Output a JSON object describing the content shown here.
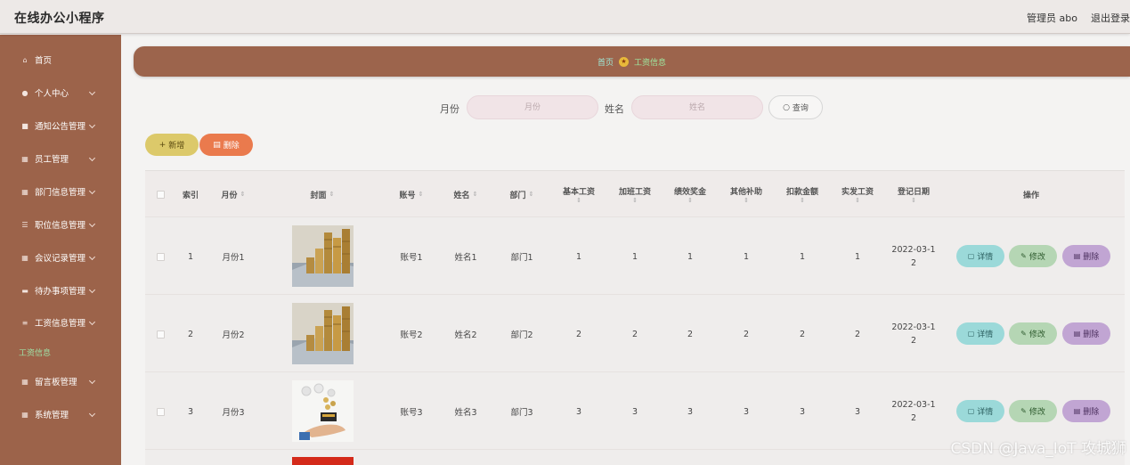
{
  "app": {
    "title": "在线办公小程序",
    "user": "管理员 abo",
    "logout": "退出登录"
  },
  "sidebar": {
    "items": [
      {
        "label": "首页",
        "icon": "home-icon",
        "expandable": false
      },
      {
        "label": "个人中心",
        "icon": "user-icon",
        "expandable": true
      },
      {
        "label": "通知公告管理",
        "icon": "notice-icon",
        "expandable": true
      },
      {
        "label": "员工管理",
        "icon": "grid-icon",
        "expandable": true
      },
      {
        "label": "部门信息管理",
        "icon": "grid-icon",
        "expandable": true
      },
      {
        "label": "职位信息管理",
        "icon": "sliders-icon",
        "expandable": true
      },
      {
        "label": "会议记录管理",
        "icon": "grid-icon",
        "expandable": true
      },
      {
        "label": "待办事项管理",
        "icon": "chat-icon",
        "expandable": true
      },
      {
        "label": "工资信息管理",
        "icon": "list-icon",
        "expandable": true
      },
      {
        "label": "留言板管理",
        "icon": "grid-icon",
        "expandable": true
      },
      {
        "label": "系统管理",
        "icon": "grid-icon",
        "expandable": true
      }
    ],
    "submenu_label": "工资信息"
  },
  "breadcrumb": {
    "home": "首页",
    "current": "工资信息"
  },
  "search": {
    "month_label": "月份",
    "month_placeholder": "月份",
    "name_label": "姓名",
    "name_placeholder": "姓名",
    "button": "查询"
  },
  "actions": {
    "add": "新增",
    "delete": "删除"
  },
  "table": {
    "columns": [
      "索引",
      "月份",
      "封面",
      "账号",
      "姓名",
      "部门",
      "基本工资",
      "加班工资",
      "绩效奖金",
      "其他补助",
      "扣款金额",
      "实发工资",
      "登记日期",
      "操作"
    ],
    "rows": [
      {
        "index": "1",
        "month": "月份1",
        "account": "账号1",
        "name": "姓名1",
        "dept": "部门1",
        "base": "1",
        "overtime": "1",
        "bonus": "1",
        "other": "1",
        "deduct": "1",
        "actual": "1",
        "date_line1": "2022-03-1",
        "date_line2": "2"
      },
      {
        "index": "2",
        "month": "月份2",
        "account": "账号2",
        "name": "姓名2",
        "dept": "部门2",
        "base": "2",
        "overtime": "2",
        "bonus": "2",
        "other": "2",
        "deduct": "2",
        "actual": "2",
        "date_line1": "2022-03-1",
        "date_line2": "2"
      },
      {
        "index": "3",
        "month": "月份3",
        "account": "账号3",
        "name": "姓名3",
        "dept": "部门3",
        "base": "3",
        "overtime": "3",
        "bonus": "3",
        "other": "3",
        "deduct": "3",
        "actual": "3",
        "date_line1": "2022-03-1",
        "date_line2": "2"
      }
    ],
    "row_actions": {
      "detail": "详情",
      "edit": "修改",
      "remove": "删除"
    }
  },
  "watermark": "CSDN @Java_IoT 攻城狮",
  "colors": {
    "sidebar": "#9c634a",
    "breadcrumb_bar": "#9c644c",
    "add_button": "#dcc96a",
    "delete_button": "#ea7a4d",
    "detail_button": "#9bd9d9",
    "edit_button": "#b5d6b4",
    "remove_button": "#c1a5d3",
    "active_submenu": "#9ee0a6"
  }
}
